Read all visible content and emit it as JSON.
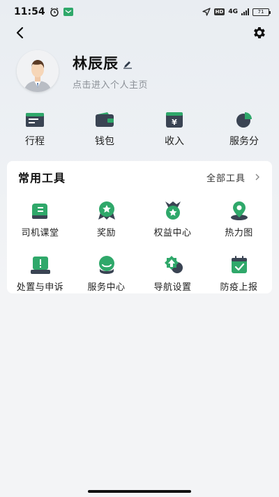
{
  "status_bar": {
    "time": "11:54",
    "network": "4G",
    "hd": "HD",
    "battery": "71"
  },
  "profile": {
    "name": "林辰辰",
    "subtitle": "点击进入个人主页"
  },
  "quick_actions": [
    {
      "label": "行程",
      "icon": "itinerary-icon"
    },
    {
      "label": "钱包",
      "icon": "wallet-icon"
    },
    {
      "label": "收入",
      "icon": "income-icon"
    },
    {
      "label": "服务分",
      "icon": "service-score-icon"
    }
  ],
  "tools_card": {
    "title": "常用工具",
    "all_label": "全部工具",
    "items": [
      {
        "label": "司机课堂",
        "icon": "driver-class-icon"
      },
      {
        "label": "奖励",
        "icon": "reward-icon"
      },
      {
        "label": "权益中心",
        "icon": "benefits-center-icon"
      },
      {
        "label": "热力图",
        "icon": "heatmap-icon"
      },
      {
        "label": "处置与申诉",
        "icon": "appeal-icon"
      },
      {
        "label": "服务中心",
        "icon": "service-center-icon"
      },
      {
        "label": "导航设置",
        "icon": "navigation-settings-icon"
      },
      {
        "label": "防疫上报",
        "icon": "epidemic-report-icon"
      }
    ]
  },
  "colors": {
    "accent_green": "#2fa86a",
    "icon_dark": "#3a4453",
    "background": "#f3f4f6"
  }
}
